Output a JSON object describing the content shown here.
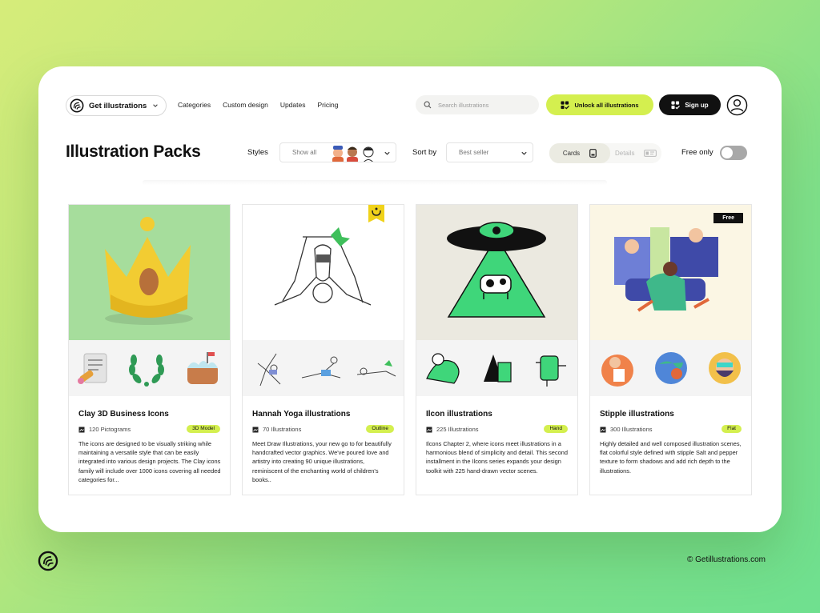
{
  "header": {
    "brand": "Get illustrations",
    "nav": [
      "Categories",
      "Custom design",
      "Updates",
      "Pricing"
    ],
    "search_placeholder": "Search illustrations",
    "unlock_label": "Unlock all illustrations",
    "signup_label": "Sign up"
  },
  "toolbar": {
    "title": "Illustration Packs",
    "styles_label": "Styles",
    "styles_value": "Show all",
    "sort_label": "Sort by",
    "sort_value": "Best seller",
    "view_cards": "Cards",
    "view_details": "Details",
    "free_only": "Free only",
    "free_only_on": false
  },
  "cards": [
    {
      "title": "Clay 3D Business Icons",
      "meta": "120 Pictograms",
      "tag": "3D Model",
      "desc": "The icons are designed to be visually striking while maintaining a versatile style that can be easily integrated into various design projects. The Clay icons family will include over 1000 icons covering all needed categories for..."
    },
    {
      "title": "Hannah Yoga illustrations",
      "meta": "70 Illustrations",
      "tag": "Outline",
      "desc": "Meet Draw Illustrations, your new go to for beautifully handcrafted vector graphics. We've poured love and artistry into creating 90 unique illustrations, reminiscent of the enchanting world of children's books.."
    },
    {
      "title": "Ilcon illustrations",
      "meta": "225 Illustrations",
      "tag": "Hand",
      "desc": "Ilcons Chapter 2, where icons meet illustrations in a harmonious blend of simplicity and detail. This second installment in the Ilcons series expands your design toolkit with 225 hand-drawn vector scenes."
    },
    {
      "title": "Stipple illustrations",
      "meta": "300 Illustrations",
      "tag": "Flat",
      "badge": "Free",
      "desc": "Highly detailed and well composed illustration scenes, flat colorful style defined with stipple Salt and pepper texture to form shadows and add rich depth to the illustrations."
    }
  ],
  "footer": {
    "copyright": "© Getillustrations.com"
  },
  "colors": {
    "accent": "#d4ef4f",
    "dark": "#111111",
    "clay_bg": "#9fdc97",
    "ufo_bg": "#ebe9e0",
    "stipple_bg": "#fbf6e4"
  }
}
